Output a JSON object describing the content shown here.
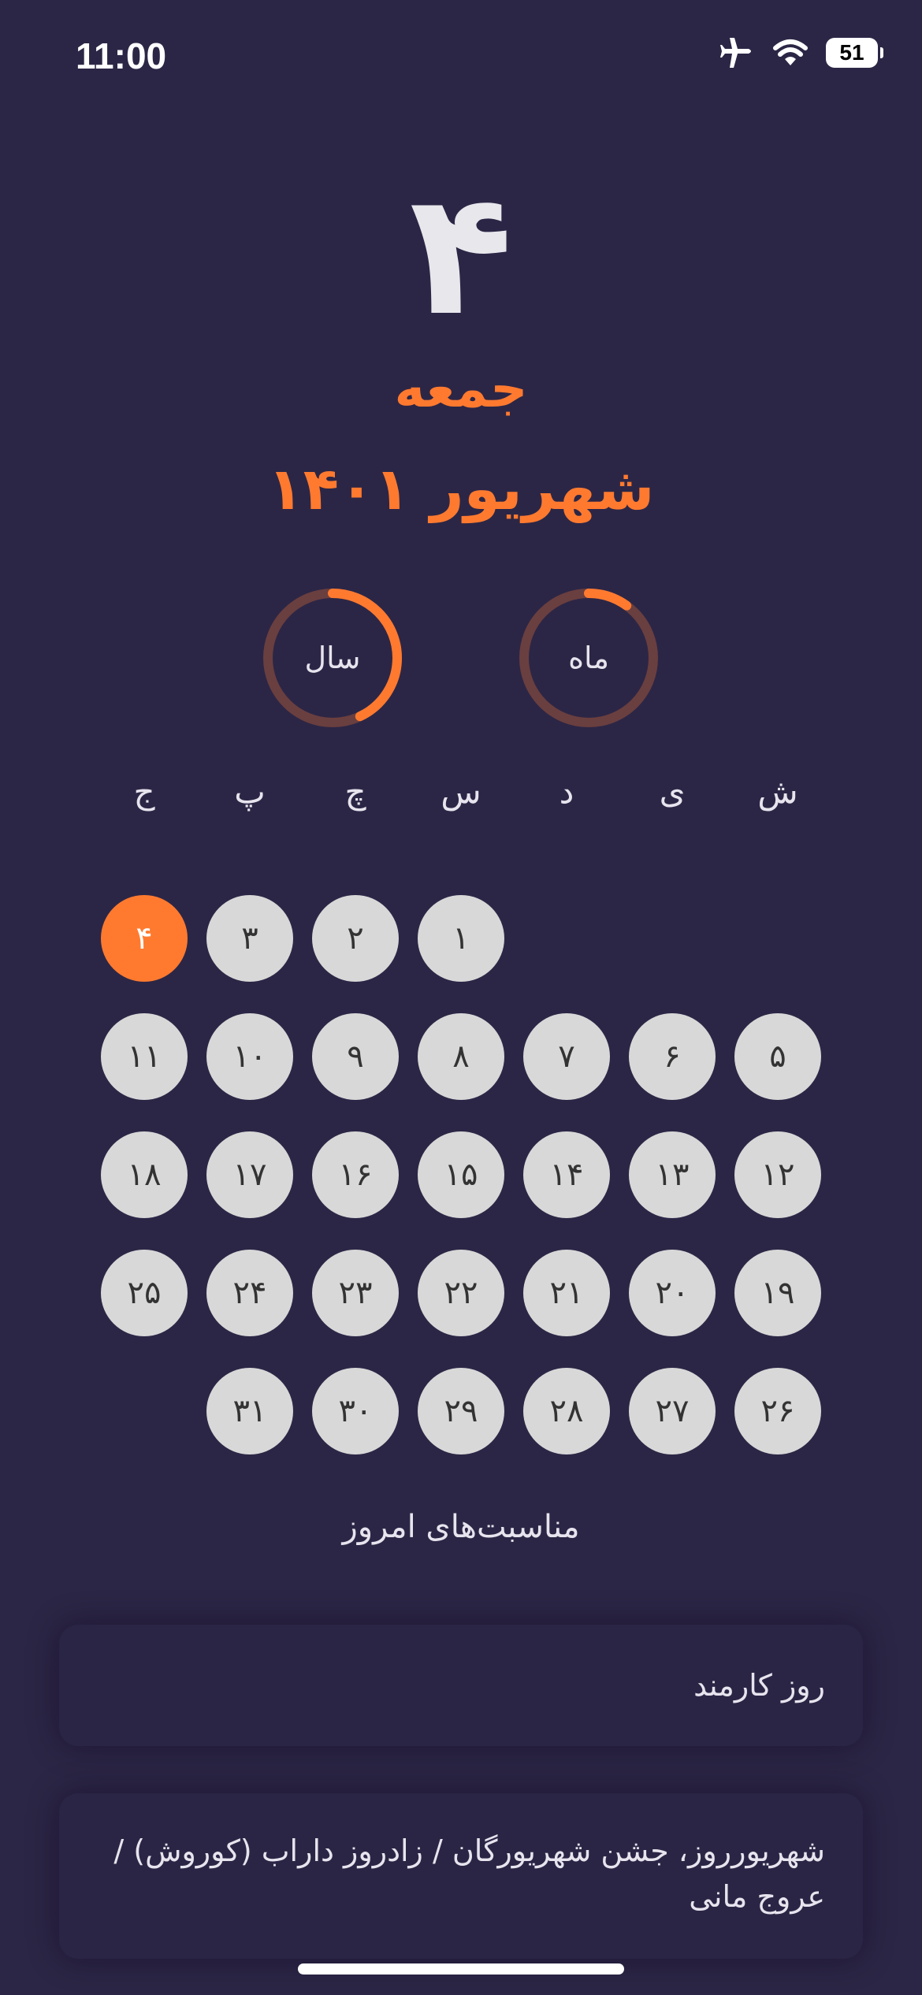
{
  "status_bar": {
    "time": "11:00",
    "battery": "51",
    "icons": [
      "airplane-icon",
      "wifi-icon",
      "battery-icon"
    ]
  },
  "header": {
    "day_number": "۴",
    "weekday": "جمعه",
    "month_year": "شهریور ۱۴۰۱"
  },
  "progress": {
    "year": {
      "label": "سال",
      "fraction": 0.43
    },
    "month": {
      "label": "ماه",
      "fraction": 0.1
    }
  },
  "week_days": [
    "ش",
    "ی",
    "د",
    "س",
    "چ",
    "پ",
    "ج"
  ],
  "calendar": {
    "today": "۴",
    "weeks": [
      [
        "",
        "",
        "",
        "۱",
        "۲",
        "۳",
        "۴"
      ],
      [
        "۵",
        "۶",
        "۷",
        "۸",
        "۹",
        "۱۰",
        "۱۱"
      ],
      [
        "۱۲",
        "۱۳",
        "۱۴",
        "۱۵",
        "۱۶",
        "۱۷",
        "۱۸"
      ],
      [
        "۱۹",
        "۲۰",
        "۲۱",
        "۲۲",
        "۲۳",
        "۲۴",
        "۲۵"
      ],
      [
        "۲۶",
        "۲۷",
        "۲۸",
        "۲۹",
        "۳۰",
        "۳۱",
        ""
      ]
    ]
  },
  "events": {
    "title": "مناسبت‌های امروز",
    "items": [
      "روز کارمند",
      "شهریورروز، جشن شهریورگان / زادروز داراب (کوروش) / عروج مانی"
    ]
  },
  "colors": {
    "background": "#2c2646",
    "accent": "#ff7a2f",
    "ring_track": "#6a3f3f",
    "day_circle": "#d8d8d8"
  }
}
